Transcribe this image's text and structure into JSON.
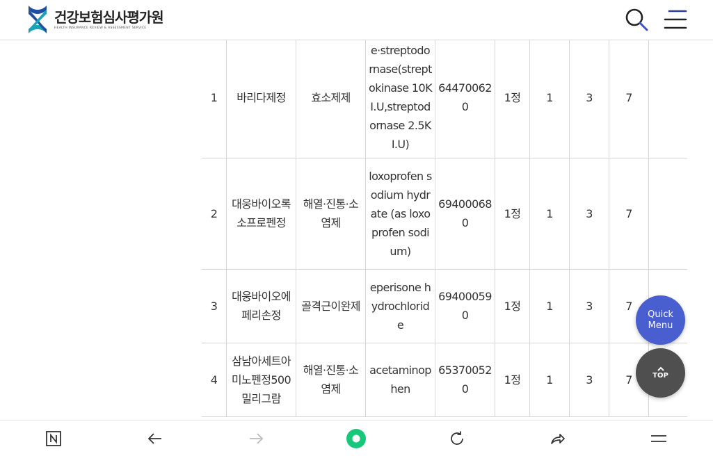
{
  "header": {
    "logo_title": "건강보험심사평가원",
    "logo_subtitle": "HEALTH INSURANCE REVIEW & ASSESSMENT SERVICE"
  },
  "table": {
    "rows": [
      {
        "no": "1",
        "product": "바리다제정",
        "category": "효소제제",
        "ingredient": "e·streptodornase(streptokinase 10KI.U,streptodornase 2.5KI.U)",
        "code": "644700620",
        "unit": "1정",
        "c1": "1",
        "c2": "3",
        "c3": "7",
        "c4": ""
      },
      {
        "no": "2",
        "product": "대웅바이오록소프로펜정",
        "category": "해열·진통·소염제",
        "ingredient": "loxoprofen sodium hydrate (as loxoprofen sodium)",
        "code": "694000680",
        "unit": "1정",
        "c1": "1",
        "c2": "3",
        "c3": "7",
        "c4": ""
      },
      {
        "no": "3",
        "product": "대웅바이오에페리손정",
        "category": "골격근이완제",
        "ingredient": "eperisone hydrochloride",
        "code": "694000590",
        "unit": "1정",
        "c1": "1",
        "c2": "3",
        "c3": "7",
        "c4": ""
      },
      {
        "no": "4",
        "product": "삼남아세트아미노펜정500밀리그람",
        "category": "해열·진통·소염제",
        "ingredient": "acetaminophen",
        "code": "653700520",
        "unit": "1정",
        "c1": "1",
        "c2": "3",
        "c3": "7",
        "c4": ""
      }
    ]
  },
  "floating": {
    "quick_menu_line1": "Quick",
    "quick_menu_line2": "Menu",
    "top_label": "TOP"
  },
  "bottombar": {
    "items": [
      "naver-home-icon",
      "back-arrow-icon",
      "forward-arrow-icon",
      "green-dot-icon",
      "refresh-icon",
      "share-icon",
      "menu-icon"
    ]
  },
  "colors": {
    "quick_menu_bg": "#4a5fcf",
    "top_bg": "#4f4f4f",
    "green_dot": "#19c77a",
    "logo_blue": "#1f4fa0",
    "logo_teal": "#1aa3b5"
  }
}
